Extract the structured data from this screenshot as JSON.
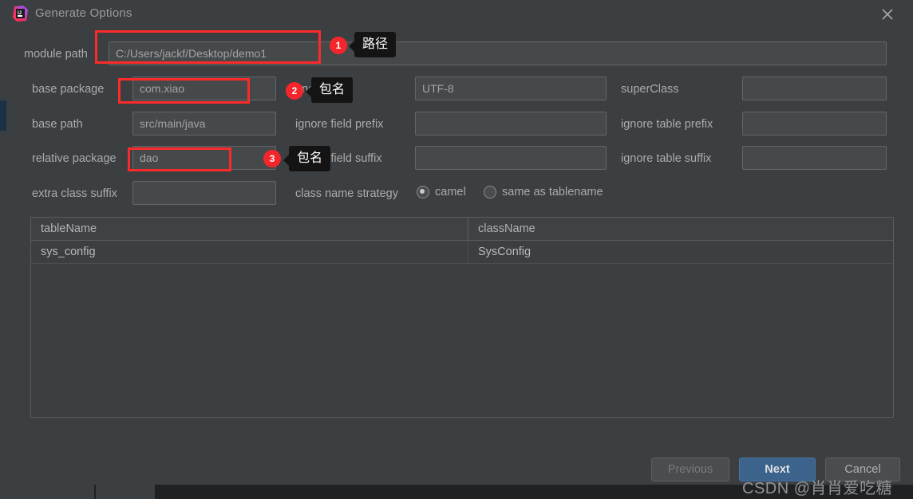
{
  "window": {
    "title": "Generate Options",
    "icon": "intellij-idea-logo",
    "close_icon": "close-icon"
  },
  "form": {
    "rows": [
      {
        "label": "module path",
        "value": "C:/Users/jackf/Desktop/demo1"
      },
      {
        "label": "base package",
        "value": "com.xiao"
      },
      {
        "label": "base path",
        "value": "src/main/java"
      },
      {
        "label": "relative package",
        "value": "dao"
      },
      {
        "label": "extra class suffix",
        "value": ""
      }
    ],
    "mid_labels": {
      "encoding": "encoding",
      "ignore_field_prefix": "ignore field prefix",
      "ignore_field_suffix": "ignore field suffix",
      "class_name_strategy": "class name strategy"
    },
    "mid_values": {
      "encoding": "UTF-8",
      "ignore_field_prefix": "",
      "ignore_field_suffix": ""
    },
    "right_labels": {
      "super_class": "superClass",
      "ignore_table_prefix": "ignore table prefix",
      "ignore_table_suffix": "ignore table suffix"
    },
    "right_values": {
      "super_class": "",
      "ignore_table_prefix": "",
      "ignore_table_suffix": ""
    },
    "class_name_strategy": {
      "options": [
        {
          "label": "camel",
          "selected": true
        },
        {
          "label": "same as tablename",
          "selected": false
        }
      ]
    }
  },
  "table": {
    "headers": [
      "tableName",
      "className"
    ],
    "rows": [
      {
        "tableName": "sys_config",
        "className": "SysConfig"
      }
    ]
  },
  "footer": {
    "previous": "Previous",
    "next": "Next",
    "cancel": "Cancel"
  },
  "annotations": [
    {
      "badge": "1",
      "tip": "路径"
    },
    {
      "badge": "2",
      "tip": "包名"
    },
    {
      "badge": "3",
      "tip": "包名"
    }
  ],
  "watermark": "CSDN @肖肖爱吃糖",
  "colors": {
    "dialog_bg": "#3c3f41",
    "field_bg": "#45494a",
    "accent_blue": "#3b638c",
    "annotation_red": "#fc2a2a",
    "ide_accent": "#1b3147"
  }
}
